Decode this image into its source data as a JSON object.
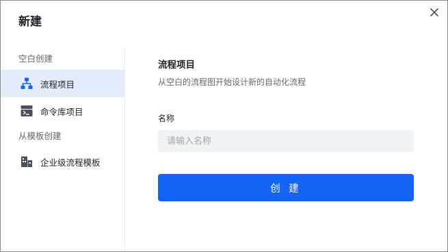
{
  "dialog": {
    "title": "新建",
    "close_icon": "close-icon"
  },
  "sidebar": {
    "blank_section_label": "空白创建",
    "items": [
      {
        "label": "流程项目",
        "icon": "flow-project-icon",
        "active": true
      },
      {
        "label": "命令库项目",
        "icon": "command-library-icon",
        "active": false
      }
    ],
    "template_section_label": "从模板创建",
    "template_items": [
      {
        "label": "企业级流程模板",
        "icon": "enterprise-template-icon",
        "active": false
      }
    ]
  },
  "main": {
    "title": "流程项目",
    "description": "从空白的流程图开始设计新的自动化流程",
    "name_label": "名称",
    "name_placeholder": "请输入名称",
    "name_value": "",
    "create_button": "创 建"
  },
  "colors": {
    "accent": "#1565f5",
    "active_item_bg": "#e4ecfb",
    "input_bg": "#f2f3f5",
    "icon_color": "#1664f3",
    "icon_gray": "#4a4f58"
  }
}
